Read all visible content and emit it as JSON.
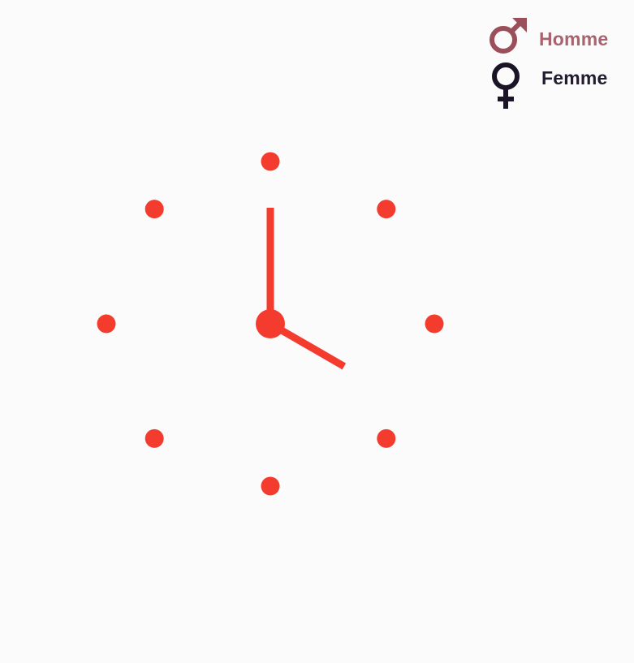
{
  "legend": {
    "items": [
      {
        "id": "male",
        "symbol": "male-symbol-icon",
        "label": "Homme",
        "color": "#9b4f5a",
        "label_color": "#a8646e"
      },
      {
        "id": "female",
        "symbol": "female-symbol-icon",
        "label": "Femme",
        "color": "#1a1426",
        "label_color": "#231c2e"
      }
    ]
  },
  "clock": {
    "accent_color": "#f43c2e",
    "hour_markers": 8,
    "time": {
      "hour": 4,
      "minute": 0
    }
  }
}
